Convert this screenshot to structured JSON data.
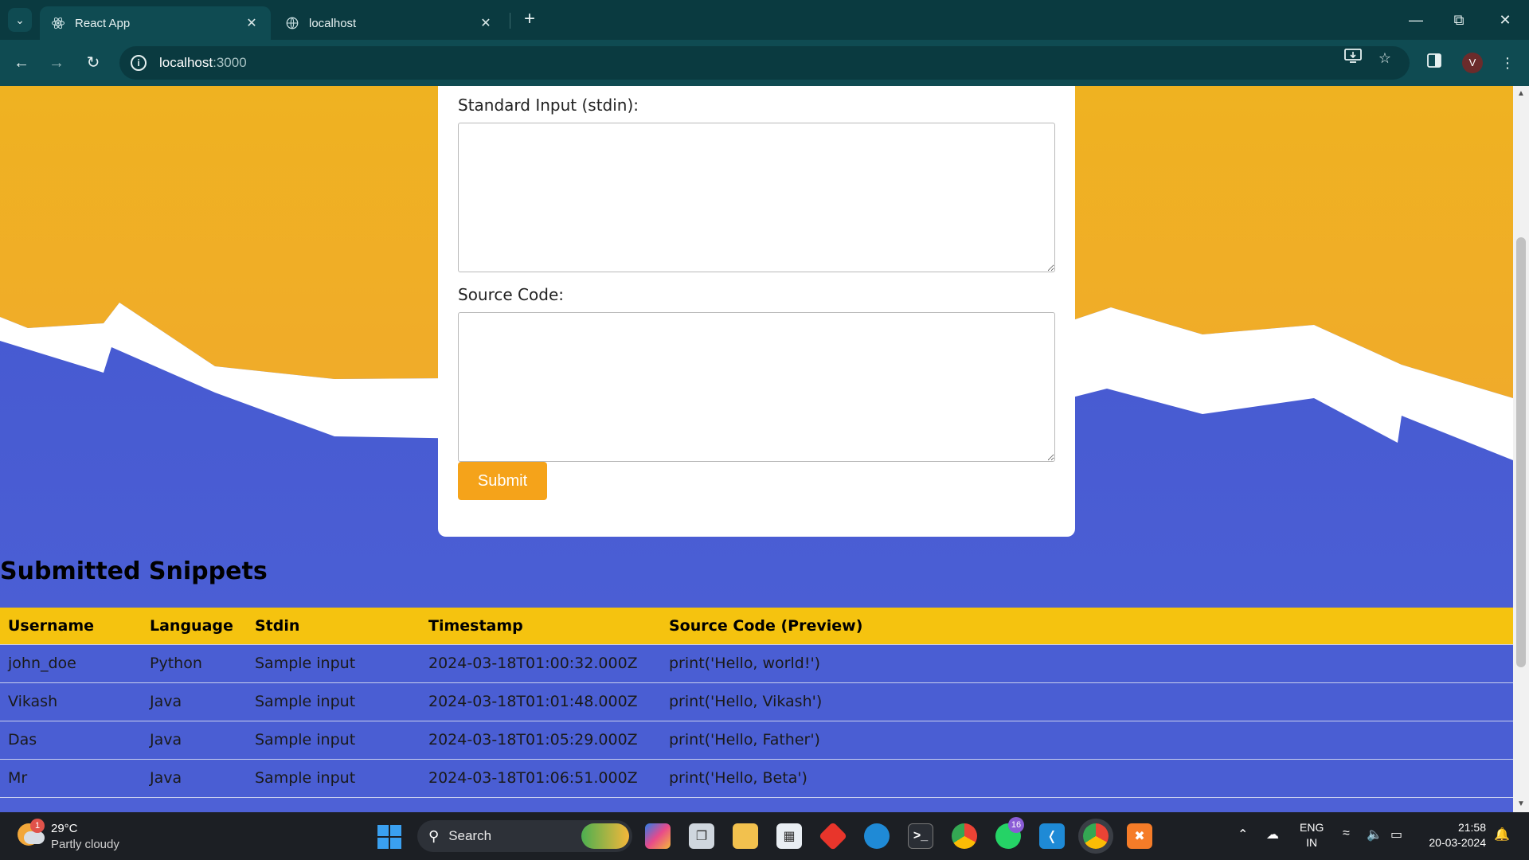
{
  "browser": {
    "tabs": [
      {
        "title": "React App",
        "active": true,
        "icon": "react-icon"
      },
      {
        "title": "localhost",
        "active": false,
        "icon": "globe-icon"
      }
    ],
    "url_host": "localhost",
    "url_port": ":3000",
    "profile_initial": "V"
  },
  "form": {
    "stdin_label": "Standard Input (stdin):",
    "stdin_value": "",
    "source_label": "Source Code:",
    "source_value": "",
    "submit_label": "Submit"
  },
  "snippets": {
    "title": "Submitted Snippets",
    "headers": [
      "Username",
      "Language",
      "Stdin",
      "Timestamp",
      "Source Code (Preview)"
    ],
    "rows": [
      [
        "john_doe",
        "Python",
        "Sample input",
        "2024-03-18T01:00:32.000Z",
        "print('Hello, world!')"
      ],
      [
        "Vikash",
        "Java",
        "Sample input",
        "2024-03-18T01:01:48.000Z",
        "print('Hello, Vikash')"
      ],
      [
        "Das",
        "Java",
        "Sample input",
        "2024-03-18T01:05:29.000Z",
        "print('Hello, Father')"
      ],
      [
        "Mr",
        "Java",
        "Sample input",
        "2024-03-18T01:06:51.000Z",
        "print('Hello, Beta')"
      ]
    ]
  },
  "colors": {
    "background_orange": "#f0b323",
    "background_blue": "#4a5ed3",
    "table_header": "#f5c30f",
    "submit_button": "#f5a31a",
    "browser_frame": "#0f4b52"
  },
  "taskbar": {
    "weather_temp": "29°C",
    "weather_condition": "Partly cloudy",
    "weather_badge": "1",
    "search_label": "Search",
    "whatsapp_badge": "16",
    "lang_line1": "ENG",
    "lang_line2": "IN",
    "time": "21:58",
    "date": "20-03-2024"
  }
}
